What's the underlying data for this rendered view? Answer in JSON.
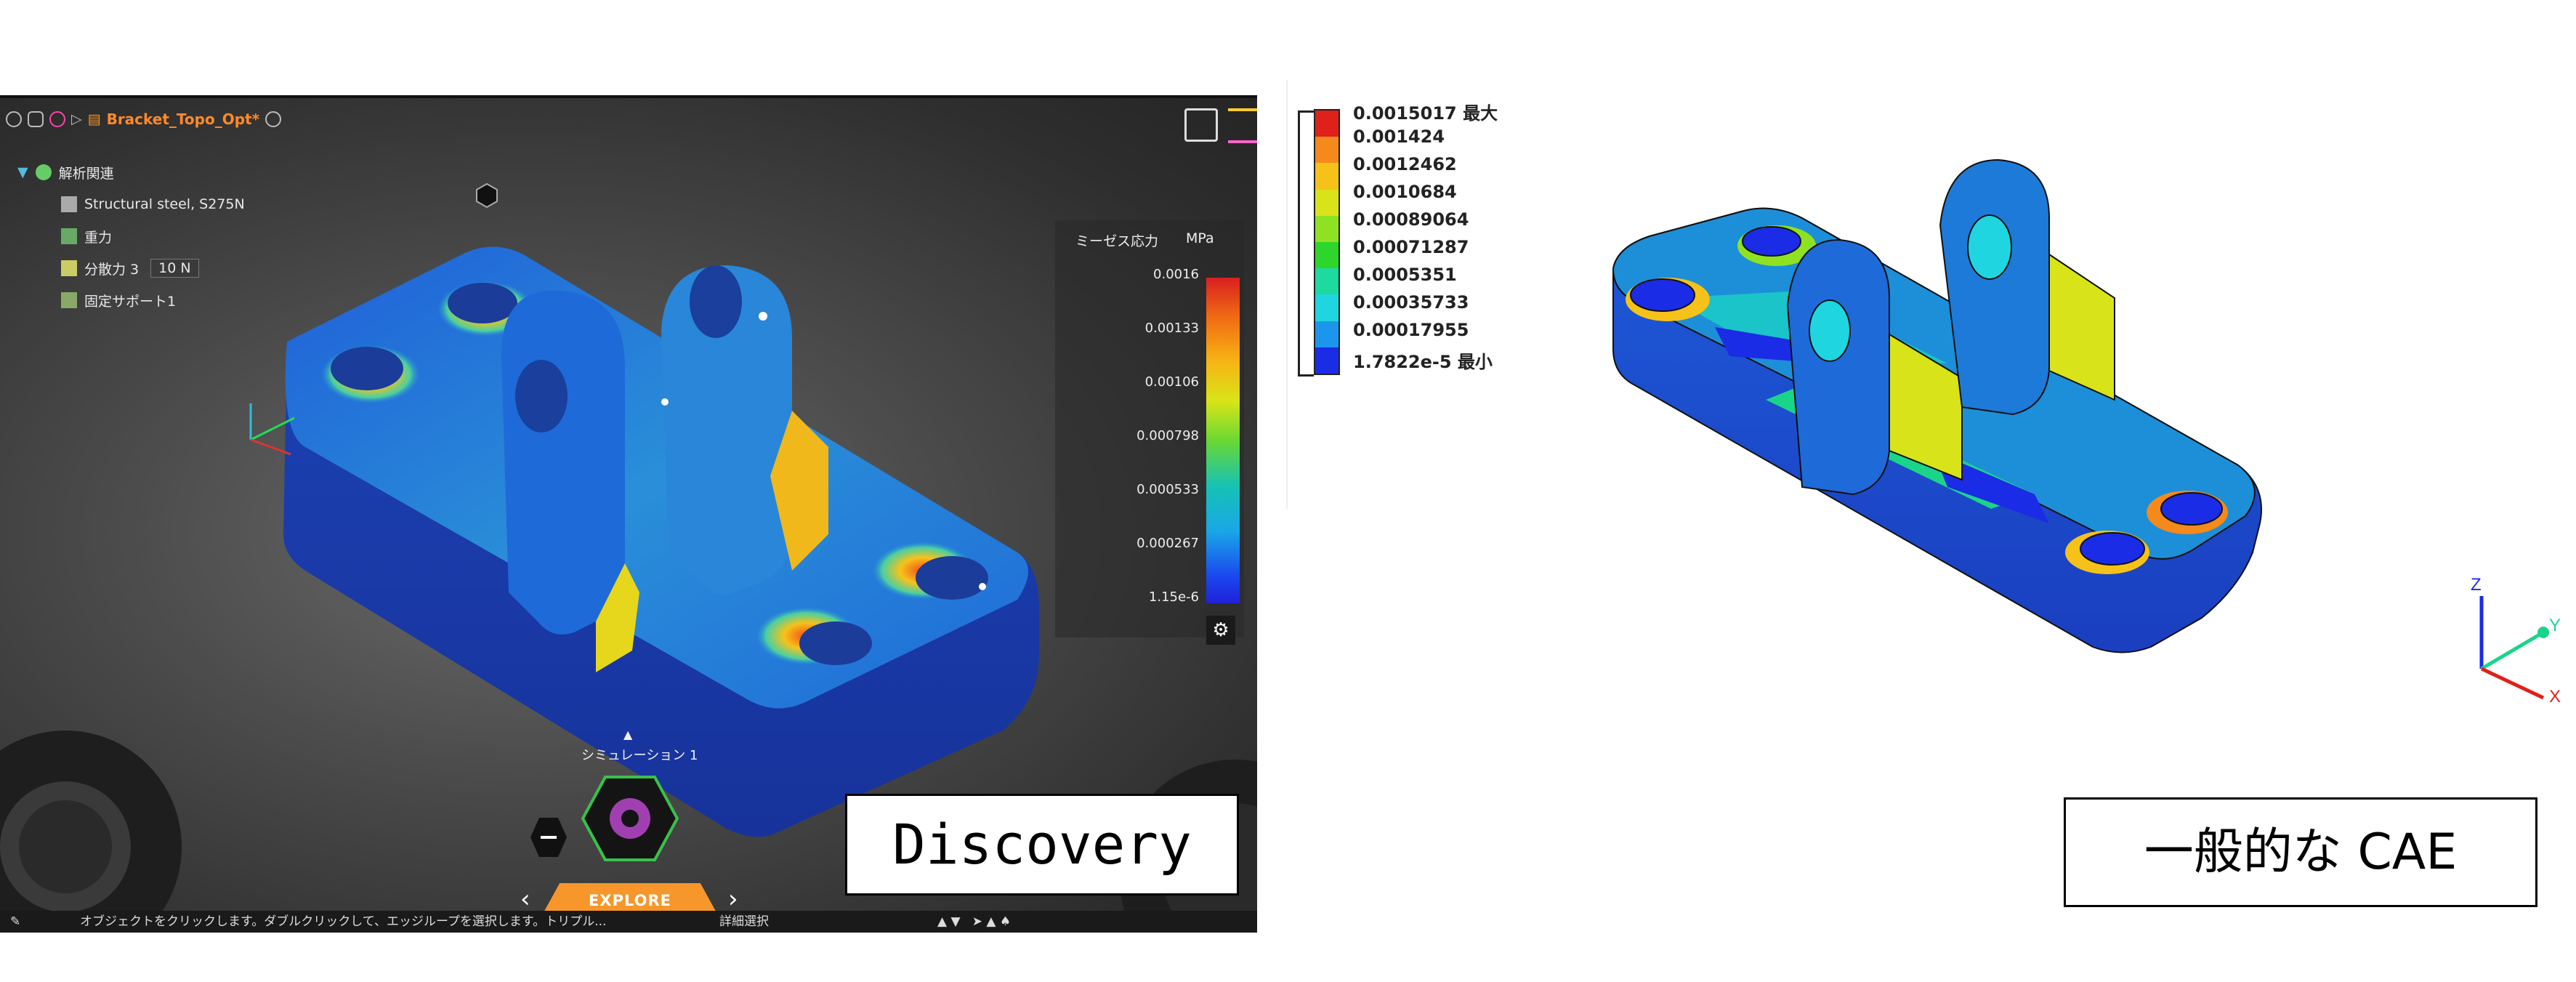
{
  "discovery": {
    "file_name": "Bracket_Topo_Opt*",
    "tree": [
      {
        "label": "解析関連"
      },
      {
        "label": "Structural steel, S275N"
      },
      {
        "label": "重力"
      },
      {
        "label": "分散力 3",
        "value": "10 N"
      },
      {
        "label": "固定サポート1"
      }
    ],
    "legend": {
      "title": "ミーゼス応力",
      "unit": "MPa",
      "labels": [
        "0.0016",
        "0.00133",
        "0.00106",
        "0.000798",
        "0.000533",
        "0.000267",
        "1.15e-6"
      ]
    },
    "simulation_label": "シミュレーション 1",
    "explore_label": "EXPLORE",
    "status_text": "オブジェクトをクリックします。ダブルクリックして、エッジループを選択します。トリプル...",
    "status_detail": "詳細選択",
    "caption": "Discovery"
  },
  "cae": {
    "legend": [
      {
        "label": "0.0015017 最大",
        "color": "#e0201a"
      },
      {
        "label": "0.001424",
        "color": "#f5891c"
      },
      {
        "label": "0.0012462",
        "color": "#f6c21a"
      },
      {
        "label": "0.0010684",
        "color": "#d8e31a"
      },
      {
        "label": "0.00089064",
        "color": "#8ee222"
      },
      {
        "label": "0.00071287",
        "color": "#2ed62c"
      },
      {
        "label": "0.0005351",
        "color": "#1ed9a0"
      },
      {
        "label": "0.00035733",
        "color": "#1fd6e0"
      },
      {
        "label": "0.00017955",
        "color": "#1b96ec"
      },
      {
        "label": "1.7822e-5 最小",
        "color": "#1a2ce6"
      }
    ],
    "caption": "一般的な CAE",
    "axes": {
      "x": "X",
      "y": "Y",
      "z": "Z"
    }
  },
  "icons": [
    "eye-icon",
    "color-wheel-icon",
    "document-icon",
    "gear-icon",
    "cube-icon",
    "home-icon",
    "orientation-cube-icon"
  ]
}
